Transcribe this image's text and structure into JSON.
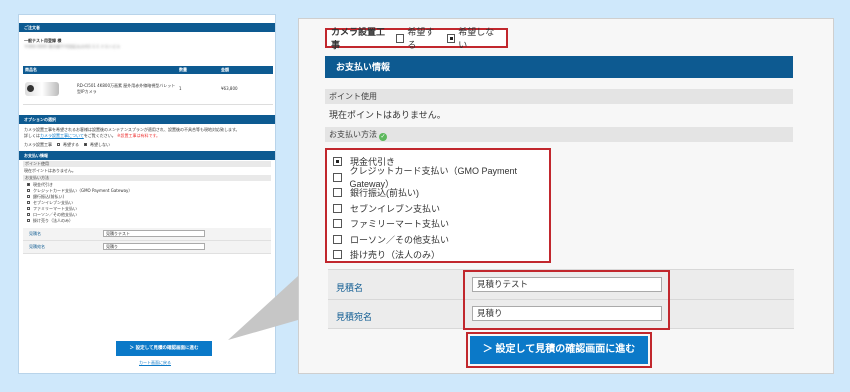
{
  "mini": {
    "order_header": "ご注文者",
    "customer": "一般テスト用登録 様",
    "address_blur": "〒000-0000 東京都千代田区丸の内1-1-1 テストビル",
    "columns": [
      "商品名",
      "数量",
      "金額"
    ],
    "product": "RD-CI501 4K800万画素 屋外用赤外線暗視型バレット型IPカメラ",
    "qty": "1",
    "price": "¥63,800",
    "options_header": "オプションの選択",
    "options_note": "カメラ設置工事を希望されるお客様は設置後のメンテナンスプランが適用され、設置後の不具合等も現地対応致します。",
    "options_note2": "詳しくは",
    "options_link": "カメラ設置工事について",
    "options_note3": "をご覧ください。",
    "options_required": "※設置工事は有料です。",
    "camera_label": "カメラ設置工事",
    "camera_opt1": "希望する",
    "camera_opt2": "希望しない",
    "pay_header": "お支払い情報",
    "points_label": "ポイント使用",
    "points_text": "現在ポイントはありません。",
    "method_label": "お支払い方法",
    "methods": [
      "現金代引き",
      "クレジットカード支払い（GMO Payment Gateway）",
      "銀行振込(前払い)",
      "セブンイレブン支払い",
      "ファミリーマート支払い",
      "ローソン／その他支払い",
      "掛け売り（法人のみ）"
    ],
    "quote_name_label": "見積名",
    "quote_name_value": "見積りテスト",
    "quote_to_label": "見積宛名",
    "quote_to_value": "見積り",
    "submit": "＞ 設定して見積の確認画面に進む",
    "cart_link": "カート画面に戻る"
  },
  "panel": {
    "camera_label": "カメラ設置工事",
    "camera_options": [
      "希望する",
      "希望しない"
    ],
    "camera_selected": "希望しない",
    "pay_header": "お支払い情報",
    "points_label": "ポイント使用",
    "points_text": "現在ポイントはありません。",
    "method_label": "お支払い方法",
    "methods": [
      "現金代引き",
      "クレジットカード支払い（GMO Payment Gateway）",
      "銀行振込(前払い)",
      "セブンイレブン支払い",
      "ファミリーマート支払い",
      "ローソン／その他支払い",
      "掛け売り（法人のみ）"
    ],
    "selected_method": "現金代引き",
    "quote_name_label": "見積名",
    "quote_name_value": "見積りテスト",
    "quote_to_label": "見積宛名",
    "quote_to_value": "見積り",
    "submit": "＞ 設定して見積の確認画面に進む"
  },
  "colors": {
    "brand_blue": "#0d5a91",
    "button_blue": "#0b79c8",
    "highlight_red": "#c1272d",
    "background": "#cfe8fb"
  }
}
